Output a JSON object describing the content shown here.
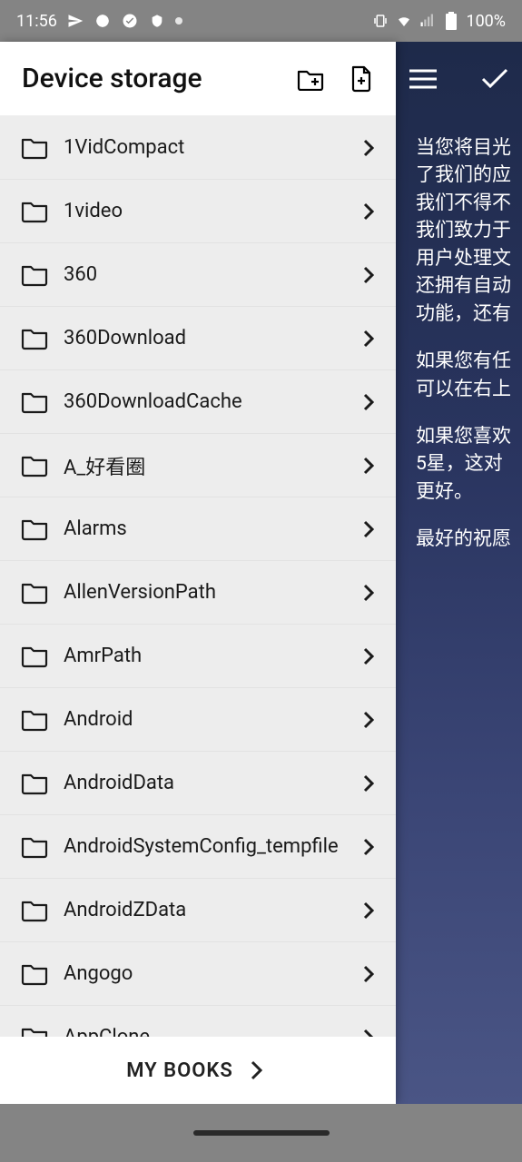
{
  "status": {
    "time": "11:56",
    "battery": "100%"
  },
  "header": {
    "title": "Device storage"
  },
  "folders": [
    {
      "name": "1VidCompact"
    },
    {
      "name": "1video"
    },
    {
      "name": "360"
    },
    {
      "name": "360Download"
    },
    {
      "name": "360DownloadCache"
    },
    {
      "name": "A_好看圈"
    },
    {
      "name": "Alarms"
    },
    {
      "name": "AllenVersionPath"
    },
    {
      "name": "AmrPath"
    },
    {
      "name": "Android"
    },
    {
      "name": "AndroidData"
    },
    {
      "name": "AndroidSystemConfig_tempfile"
    },
    {
      "name": "AndroidZData"
    },
    {
      "name": "Angogo"
    },
    {
      "name": "AppClone"
    }
  ],
  "footer": {
    "my_books": "MY BOOKS"
  },
  "background": {
    "p1l1": "当您将目光",
    "p1l2": "了我们的应",
    "p1l3": "我们不得不",
    "p1l4": "我们致力于",
    "p1l5": "用户处理文",
    "p1l6": "还拥有自动",
    "p1l7": "功能，还有",
    "p2l1": "如果您有任",
    "p2l2": "可以在右上",
    "p3l1": "如果您喜欢",
    "p3l2": "5星，这对",
    "p3l3": "更好。",
    "p4l1": "最好的祝愿"
  }
}
